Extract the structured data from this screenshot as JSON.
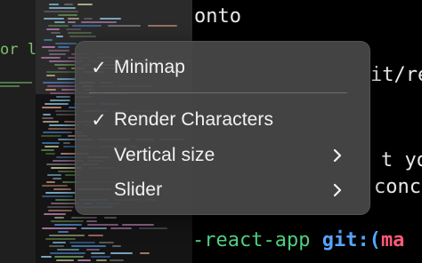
{
  "editor": {
    "snippet": "or l"
  },
  "terminal": {
    "lines": [
      {
        "text": "onto"
      },
      {
        "text": "it/re"
      },
      {
        "text": "t you"
      },
      {
        "text": "conc"
      }
    ],
    "prompt": {
      "dir": "-react-app",
      "git_label": "git:(",
      "branch_partial": "ma"
    }
  },
  "menu": {
    "items": [
      {
        "label": "Minimap",
        "checked": true,
        "has_submenu": false
      },
      {
        "label": "Render Characters",
        "checked": true,
        "has_submenu": false
      },
      {
        "label": "Vertical size",
        "checked": false,
        "has_submenu": true
      },
      {
        "label": "Slider",
        "checked": false,
        "has_submenu": true
      }
    ],
    "check_glyph": "✓"
  },
  "colors": {
    "menu_bg": "#484848",
    "terminal_bg": "#000000",
    "editor_green": "#7cbf6a",
    "prompt_green": "#4fd080",
    "prompt_blue": "#58a6ff",
    "prompt_red": "#ff5a7a"
  },
  "icons": {
    "check": "checkmark-icon",
    "submenu": "chevron-right-icon"
  }
}
